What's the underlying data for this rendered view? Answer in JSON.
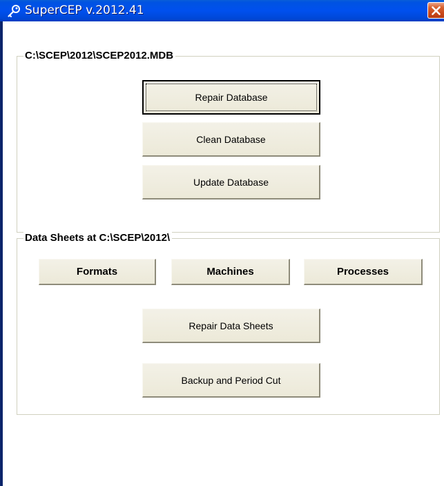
{
  "window": {
    "title": "SuperCEP v.2012.41",
    "icon": "key-icon",
    "close_icon": "close-icon"
  },
  "database_group": {
    "legend": "C:\\SCEP\\2012\\SCEP2012.MDB",
    "buttons": {
      "repair": "Repair Database",
      "clean": "Clean Database",
      "update": "Update Database"
    }
  },
  "datasheets_group": {
    "legend": "Data Sheets at C:\\SCEP\\2012\\",
    "buttons": {
      "formats": "Formats",
      "machines": "Machines",
      "processes": "Processes",
      "repair_sheets": "Repair Data Sheets",
      "backup": "Backup and Period Cut"
    }
  },
  "colors": {
    "titlebar": "#0050ee",
    "button_face": "#ece9d8",
    "group_border": "#d0d0bf",
    "close_button": "#c8471a"
  }
}
